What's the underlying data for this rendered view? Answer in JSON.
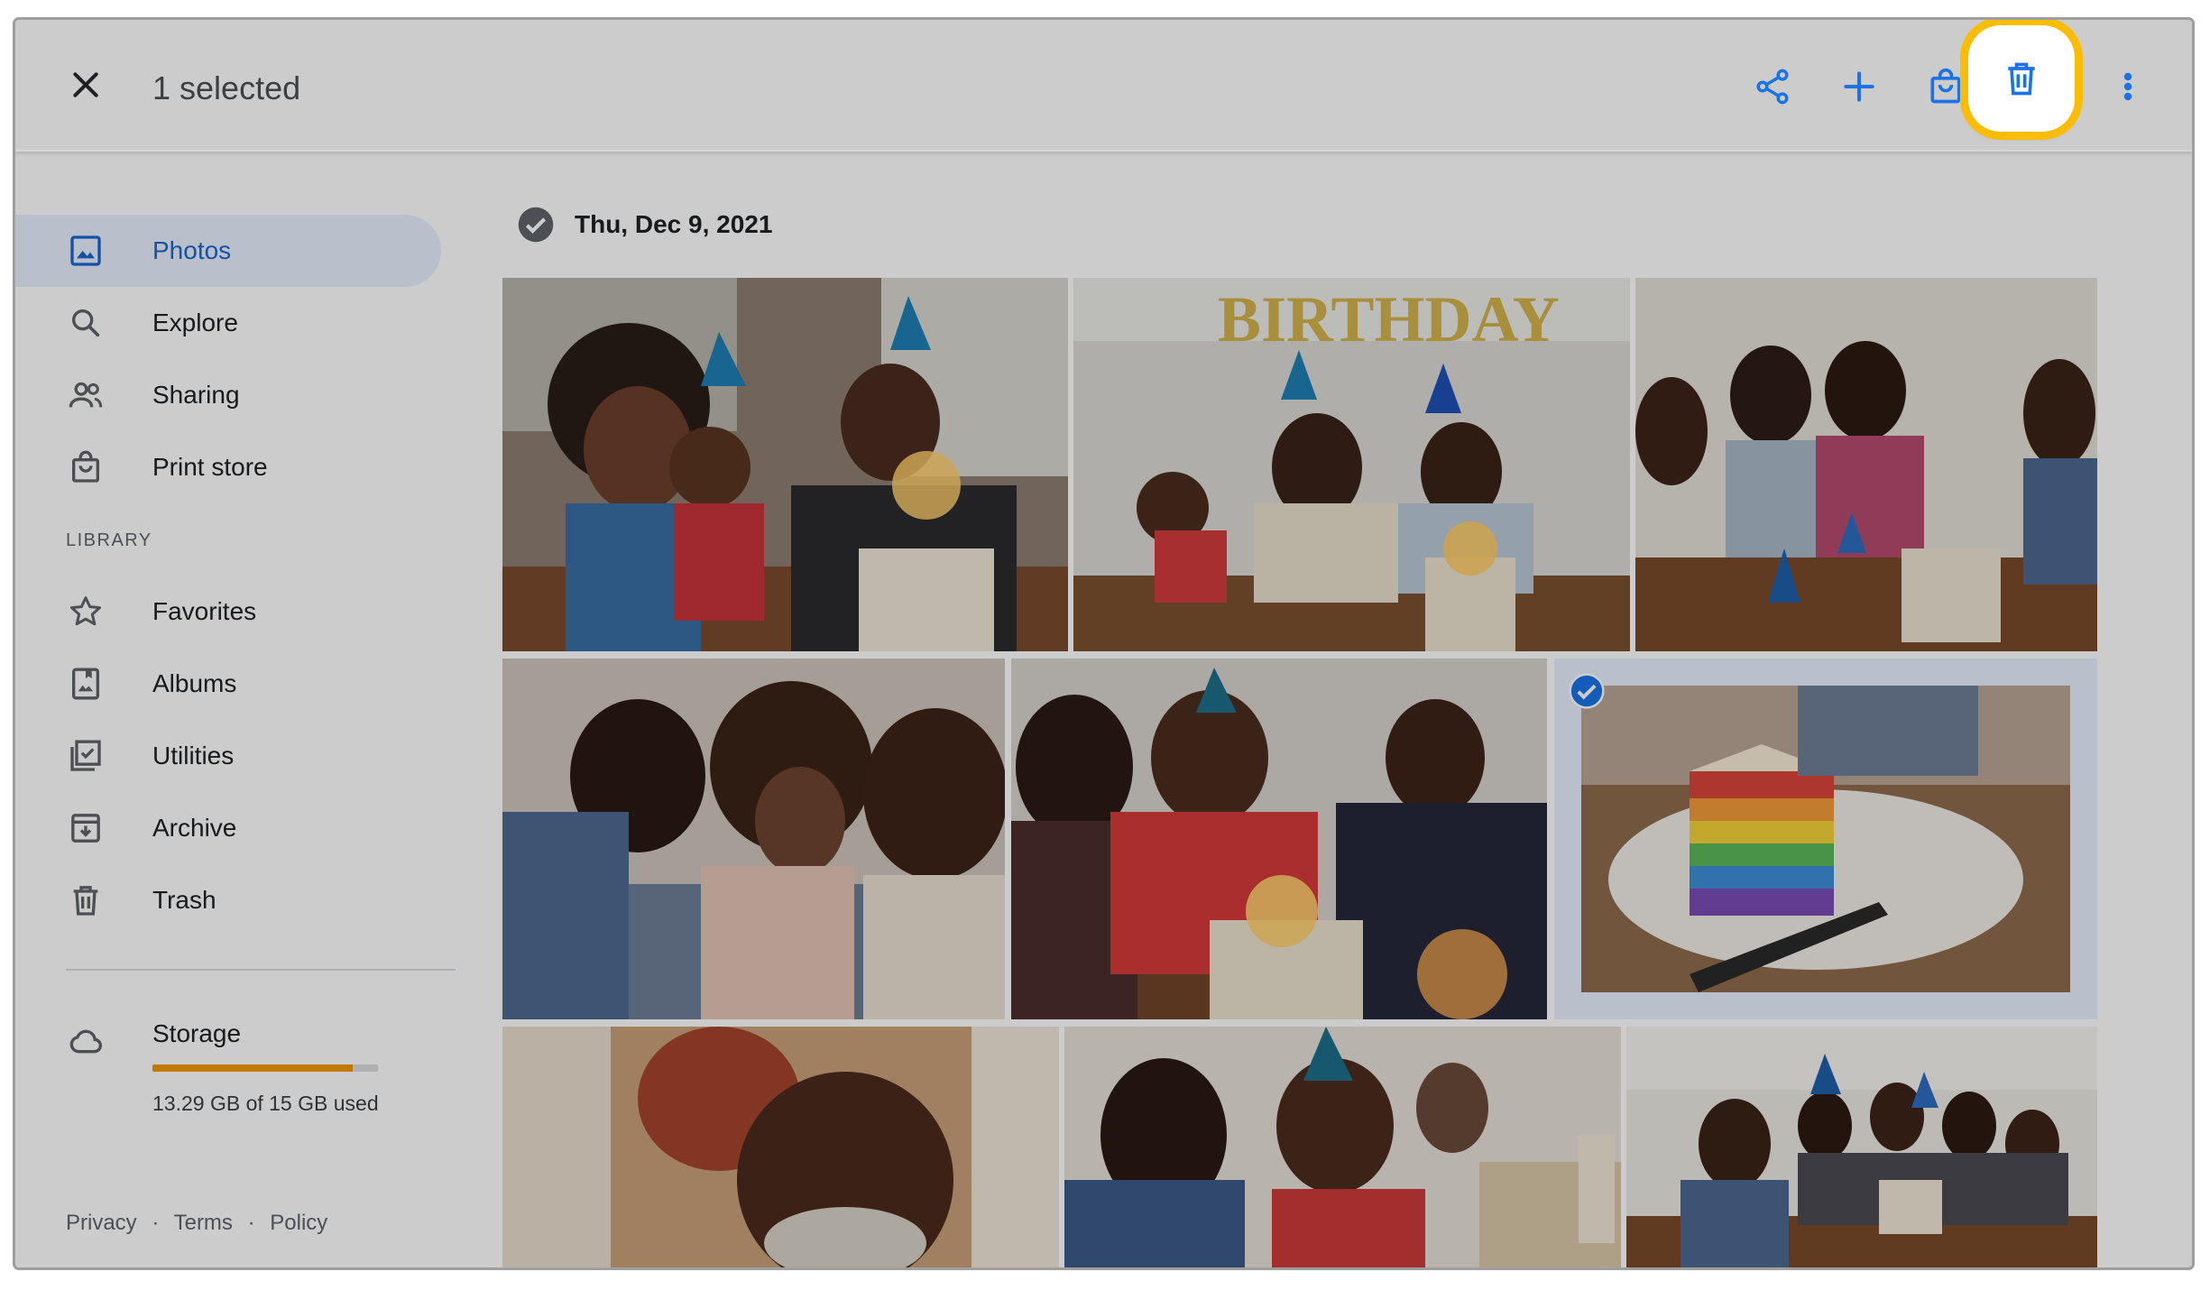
{
  "header": {
    "selected_label": "1 selected"
  },
  "sidebar": {
    "items": [
      {
        "label": "Photos",
        "icon": "photo-icon"
      },
      {
        "label": "Explore",
        "icon": "search-icon"
      },
      {
        "label": "Sharing",
        "icon": "people-icon"
      },
      {
        "label": "Print store",
        "icon": "shopping-bag-icon"
      }
    ],
    "library_label": "LIBRARY",
    "library_items": [
      {
        "label": "Favorites",
        "icon": "star-icon"
      },
      {
        "label": "Albums",
        "icon": "album-icon"
      },
      {
        "label": "Utilities",
        "icon": "utilities-icon"
      },
      {
        "label": "Archive",
        "icon": "archive-icon"
      },
      {
        "label": "Trash",
        "icon": "trash-icon"
      }
    ],
    "storage": {
      "label": "Storage",
      "used_text": "13.29 GB of 15 GB used",
      "fraction_used": 0.886
    },
    "footer": {
      "privacy": "Privacy",
      "terms": "Terms",
      "policy": "Policy",
      "separator": "·"
    }
  },
  "main": {
    "date_label": "Thu, Dec 9, 2021",
    "photos_count": 9,
    "balloon_text": "BIRTHDAY"
  },
  "colors": {
    "accent": "#1a73e8",
    "highlight": "#fbbc04",
    "storage_fill": "#f29900"
  }
}
